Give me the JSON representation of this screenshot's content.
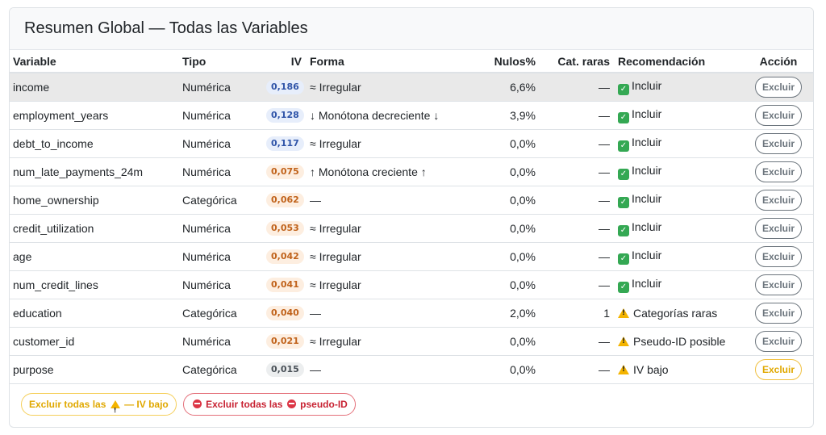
{
  "title": "Resumen Global — Todas las Variables",
  "columns": {
    "variable": "Variable",
    "tipo": "Tipo",
    "iv": "IV",
    "forma": "Forma",
    "nulos": "Nulos%",
    "cat": "Cat. raras",
    "rec": "Recomendación",
    "accion": "Acción"
  },
  "rows": [
    {
      "variable": "income",
      "tipo": "Numérica",
      "iv": "0,186",
      "iv_color": "blue",
      "forma": "≈ Irregular",
      "nulos": "6,6%",
      "cat": "—",
      "rec_icon": "check-icon",
      "rec": "Incluir",
      "accion": "Excluir",
      "highlight": true
    },
    {
      "variable": "employment_years",
      "tipo": "Numérica",
      "iv": "0,128",
      "iv_color": "blue",
      "forma": "↓ Monótona decreciente ↓",
      "nulos": "3,9%",
      "cat": "—",
      "rec_icon": "check-icon",
      "rec": "Incluir",
      "accion": "Excluir"
    },
    {
      "variable": "debt_to_income",
      "tipo": "Numérica",
      "iv": "0,117",
      "iv_color": "blue",
      "forma": "≈ Irregular",
      "nulos": "0,0%",
      "cat": "—",
      "rec_icon": "check-icon",
      "rec": "Incluir",
      "accion": "Excluir"
    },
    {
      "variable": "num_late_payments_24m",
      "tipo": "Numérica",
      "iv": "0,075",
      "iv_color": "orange",
      "forma": "↑ Monótona creciente ↑",
      "nulos": "0,0%",
      "cat": "—",
      "rec_icon": "check-icon",
      "rec": "Incluir",
      "accion": "Excluir"
    },
    {
      "variable": "home_ownership",
      "tipo": "Categórica",
      "iv": "0,062",
      "iv_color": "orange",
      "forma": "—",
      "nulos": "0,0%",
      "cat": "—",
      "rec_icon": "check-icon",
      "rec": "Incluir",
      "accion": "Excluir"
    },
    {
      "variable": "credit_utilization",
      "tipo": "Numérica",
      "iv": "0,053",
      "iv_color": "orange",
      "forma": "≈ Irregular",
      "nulos": "0,0%",
      "cat": "—",
      "rec_icon": "check-icon",
      "rec": "Incluir",
      "accion": "Excluir"
    },
    {
      "variable": "age",
      "tipo": "Numérica",
      "iv": "0,042",
      "iv_color": "orange",
      "forma": "≈ Irregular",
      "nulos": "0,0%",
      "cat": "—",
      "rec_icon": "check-icon",
      "rec": "Incluir",
      "accion": "Excluir"
    },
    {
      "variable": "num_credit_lines",
      "tipo": "Numérica",
      "iv": "0,041",
      "iv_color": "orange",
      "forma": "≈ Irregular",
      "nulos": "0,0%",
      "cat": "—",
      "rec_icon": "check-icon",
      "rec": "Incluir",
      "accion": "Excluir"
    },
    {
      "variable": "education",
      "tipo": "Categórica",
      "iv": "0,040",
      "iv_color": "orange",
      "forma": "—",
      "nulos": "2,0%",
      "cat": "1",
      "rec_icon": "warning-icon",
      "rec": "Categorías raras",
      "accion": "Excluir"
    },
    {
      "variable": "customer_id",
      "tipo": "Numérica",
      "iv": "0,021",
      "iv_color": "orange",
      "forma": "≈ Irregular",
      "nulos": "0,0%",
      "cat": "—",
      "rec_icon": "warning-icon",
      "rec": "Pseudo-ID posible",
      "accion": "Excluir"
    },
    {
      "variable": "purpose",
      "tipo": "Categórica",
      "iv": "0,015",
      "iv_color": "grey",
      "forma": "—",
      "nulos": "0,0%",
      "cat": "—",
      "rec_icon": "warning-icon",
      "rec": "IV bajo",
      "accion": "Excluir",
      "accion_style": "warn"
    }
  ],
  "footer": {
    "btn_low_iv_prefix": "Excluir todas las",
    "btn_low_iv_suffix": "— IV bajo",
    "btn_pseudo_prefix": "Excluir todas las",
    "btn_pseudo_suffix": "pseudo-ID"
  },
  "colors": {
    "iv_blue_bg": "#e7eefb",
    "iv_orange_bg": "#fdeee0",
    "warning": "#f4b400",
    "danger": "#dc3545",
    "success": "#34a853"
  }
}
